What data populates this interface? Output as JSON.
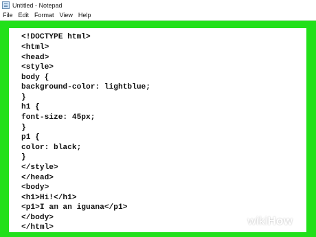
{
  "window": {
    "title": "Untitled - Notepad",
    "icon": "notepad-icon"
  },
  "menubar": {
    "items": [
      "File",
      "Edit",
      "Format",
      "View",
      "Help"
    ]
  },
  "editor": {
    "lines": [
      "<!DOCTYPE html>",
      "<html>",
      "<head>",
      "<style>",
      "body {",
      "background-color: lightblue;",
      "}",
      "h1 {",
      "font-size: 45px;",
      "}",
      "p1 {",
      "color: black;",
      "}",
      "</style>",
      "</head>",
      "<body>",
      "<h1>Hi!</h1>",
      "<p1>I am an iguana</p1>",
      "</body>",
      "</html>"
    ]
  },
  "watermark": {
    "part1": "wiki",
    "part2": "How"
  },
  "colors": {
    "highlight": "#22e01a"
  }
}
